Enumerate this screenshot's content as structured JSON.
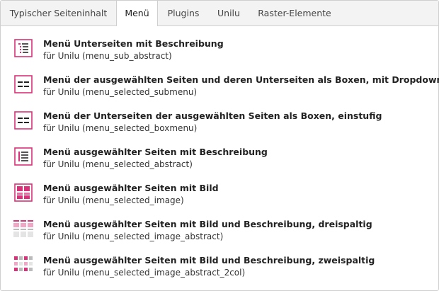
{
  "tabs": [
    {
      "label": "Typischer Seiteninhalt",
      "active": false
    },
    {
      "label": "Menü",
      "active": true
    },
    {
      "label": "Plugins",
      "active": false
    },
    {
      "label": "Unilu",
      "active": false
    },
    {
      "label": "Raster-Elemente",
      "active": false
    }
  ],
  "items": [
    {
      "title": "Menü Unterseiten mit Beschreibung",
      "subtitle": "für Unilu (menu_sub_abstract)",
      "icon": "list-with-description-icon"
    },
    {
      "title": "Menü der ausgewählten Seiten und deren Unterseiten als Boxen, mit Dropdown",
      "subtitle": "für Unilu (menu_selected_submenu)",
      "icon": "boxes-menu-icon"
    },
    {
      "title": "Menü der Unterseiten der ausgewählten Seiten als Boxen, einstufig",
      "subtitle": "für Unilu (menu_selected_boxmenu)",
      "icon": "boxes-menu-icon"
    },
    {
      "title": "Menü ausgewählter Seiten mit Beschreibung",
      "subtitle": "für Unilu (menu_selected_abstract)",
      "icon": "selected-abstract-icon"
    },
    {
      "title": "Menü ausgewählter Seiten mit Bild",
      "subtitle": "für Unilu (menu_selected_image)",
      "icon": "image-grid-icon"
    },
    {
      "title": "Menü ausgewählter Seiten mit Bild und Beschreibung, dreispaltig",
      "subtitle": "für Unilu (menu_selected_image_abstract)",
      "icon": "three-column-image-icon"
    },
    {
      "title": "Menü ausgewählter Seiten mit Bild und Beschreibung, zweispaltig",
      "subtitle": "für Unilu (menu_selected_image_abstract_2col)",
      "icon": "two-column-image-icon"
    }
  ],
  "colors": {
    "accent": "#d8317a",
    "accent_light": "#f2a6c6",
    "border": "#cfcfcf",
    "tabbar_bg": "#f3f3f3"
  }
}
